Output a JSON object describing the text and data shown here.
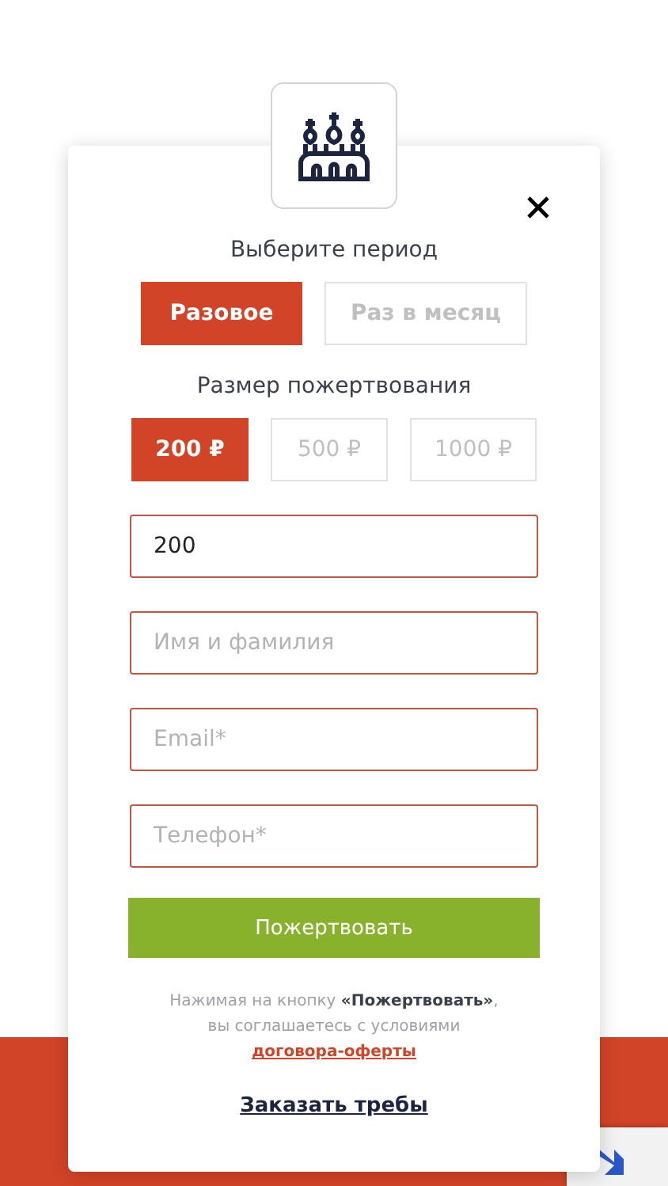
{
  "period": {
    "title": "Выберите период",
    "options": [
      {
        "label": "Разовое",
        "selected": true
      },
      {
        "label": "Раз в месяц",
        "selected": false
      }
    ]
  },
  "amount": {
    "title": "Размер пожертвования",
    "options": [
      {
        "label": "200 ₽",
        "selected": true
      },
      {
        "label": "500 ₽",
        "selected": false
      },
      {
        "label": "1000 ₽",
        "selected": false
      }
    ]
  },
  "fields": [
    {
      "value": "200"
    },
    {
      "placeholder": "Имя и фамилия"
    },
    {
      "placeholder": "Email*"
    },
    {
      "placeholder": "Телефон*"
    }
  ],
  "submit": "Пожертвовать",
  "consent": "Нажимая на кнопку **«Пожертвовать»**,",
  "consent_line2": "вы соглашаетесь с условиями",
  "consent_link": "договора-оферты",
  "order_link": "Заказать требы"
}
